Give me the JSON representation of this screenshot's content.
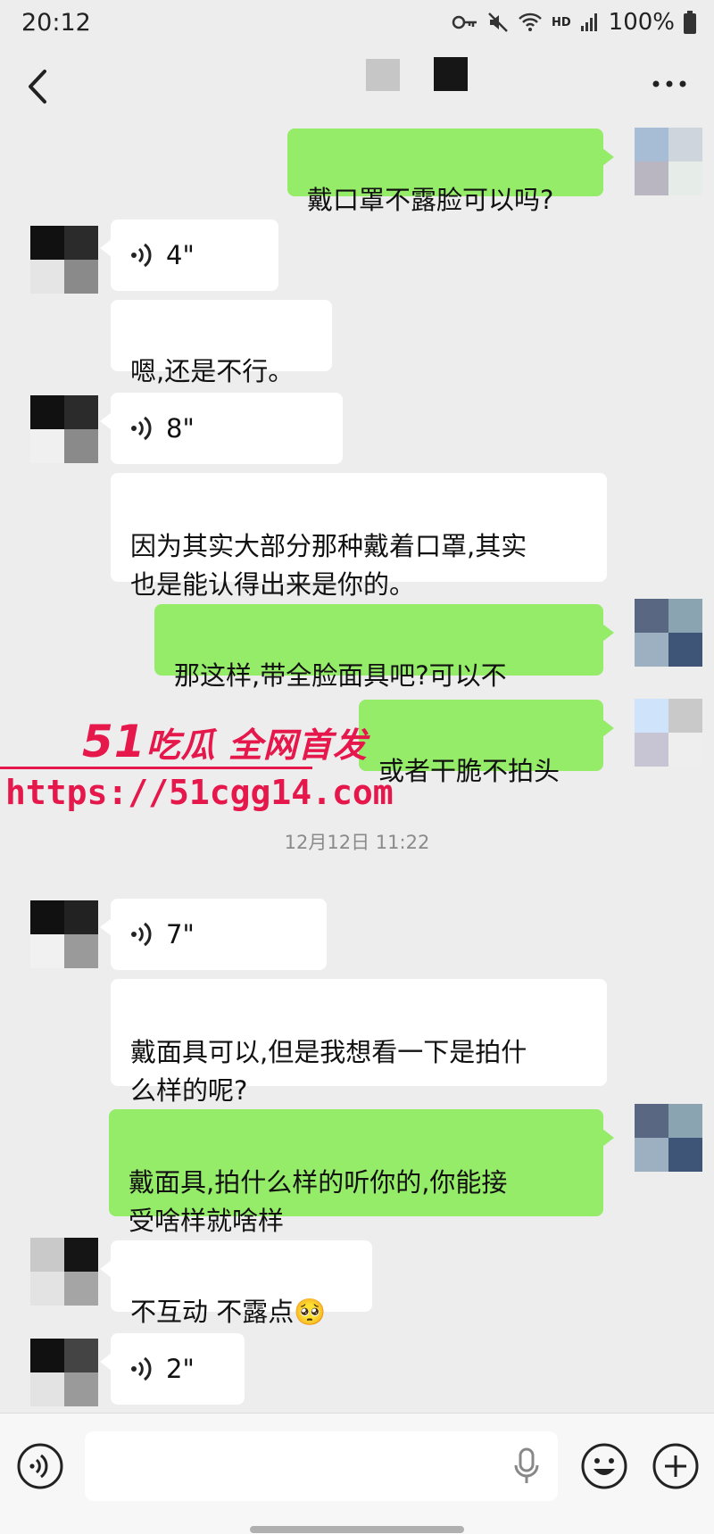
{
  "status_bar": {
    "time": "20:12",
    "hd": "HD",
    "battery": "100%"
  },
  "messages": [
    {
      "dir": "out",
      "text": "戴口罩不露脸可以吗?"
    },
    {
      "dir": "in",
      "voice_duration": "4\""
    },
    {
      "dir": "in",
      "text": "嗯,还是不行。"
    },
    {
      "dir": "in",
      "voice_duration": "8\""
    },
    {
      "dir": "in",
      "text": "因为其实大部分那种戴着口罩,其实\n也是能认得出来是你的。"
    },
    {
      "dir": "out",
      "text": "那这样,带全脸面具吧?可以不"
    },
    {
      "dir": "out",
      "text": "或者干脆不拍头"
    },
    {
      "dir": "in",
      "voice_duration": "7\""
    },
    {
      "dir": "in",
      "text": "戴面具可以,但是我想看一下是拍什\n么样的呢?"
    },
    {
      "dir": "out",
      "text": "戴面具,拍什么样的听你的,你能接\n受啥样就啥样"
    },
    {
      "dir": "in",
      "text": "不互动 不露点🥺"
    },
    {
      "dir": "in",
      "voice_duration": "2\""
    }
  ],
  "timestamp": "12月12日 11:22",
  "watermark": {
    "num": "51",
    "brand": "吃瓜 全网首发",
    "url": "https://51cgg14.com"
  },
  "colors": {
    "outgoing_bubble": "#95ec69",
    "incoming_bubble": "#ffffff",
    "background": "#ededed",
    "watermark": "#e5174b"
  },
  "icons": [
    "back-icon",
    "more-icon",
    "voice-wave-icon",
    "voice-toggle-icon",
    "mic-icon",
    "emoji-icon",
    "add-icon"
  ]
}
